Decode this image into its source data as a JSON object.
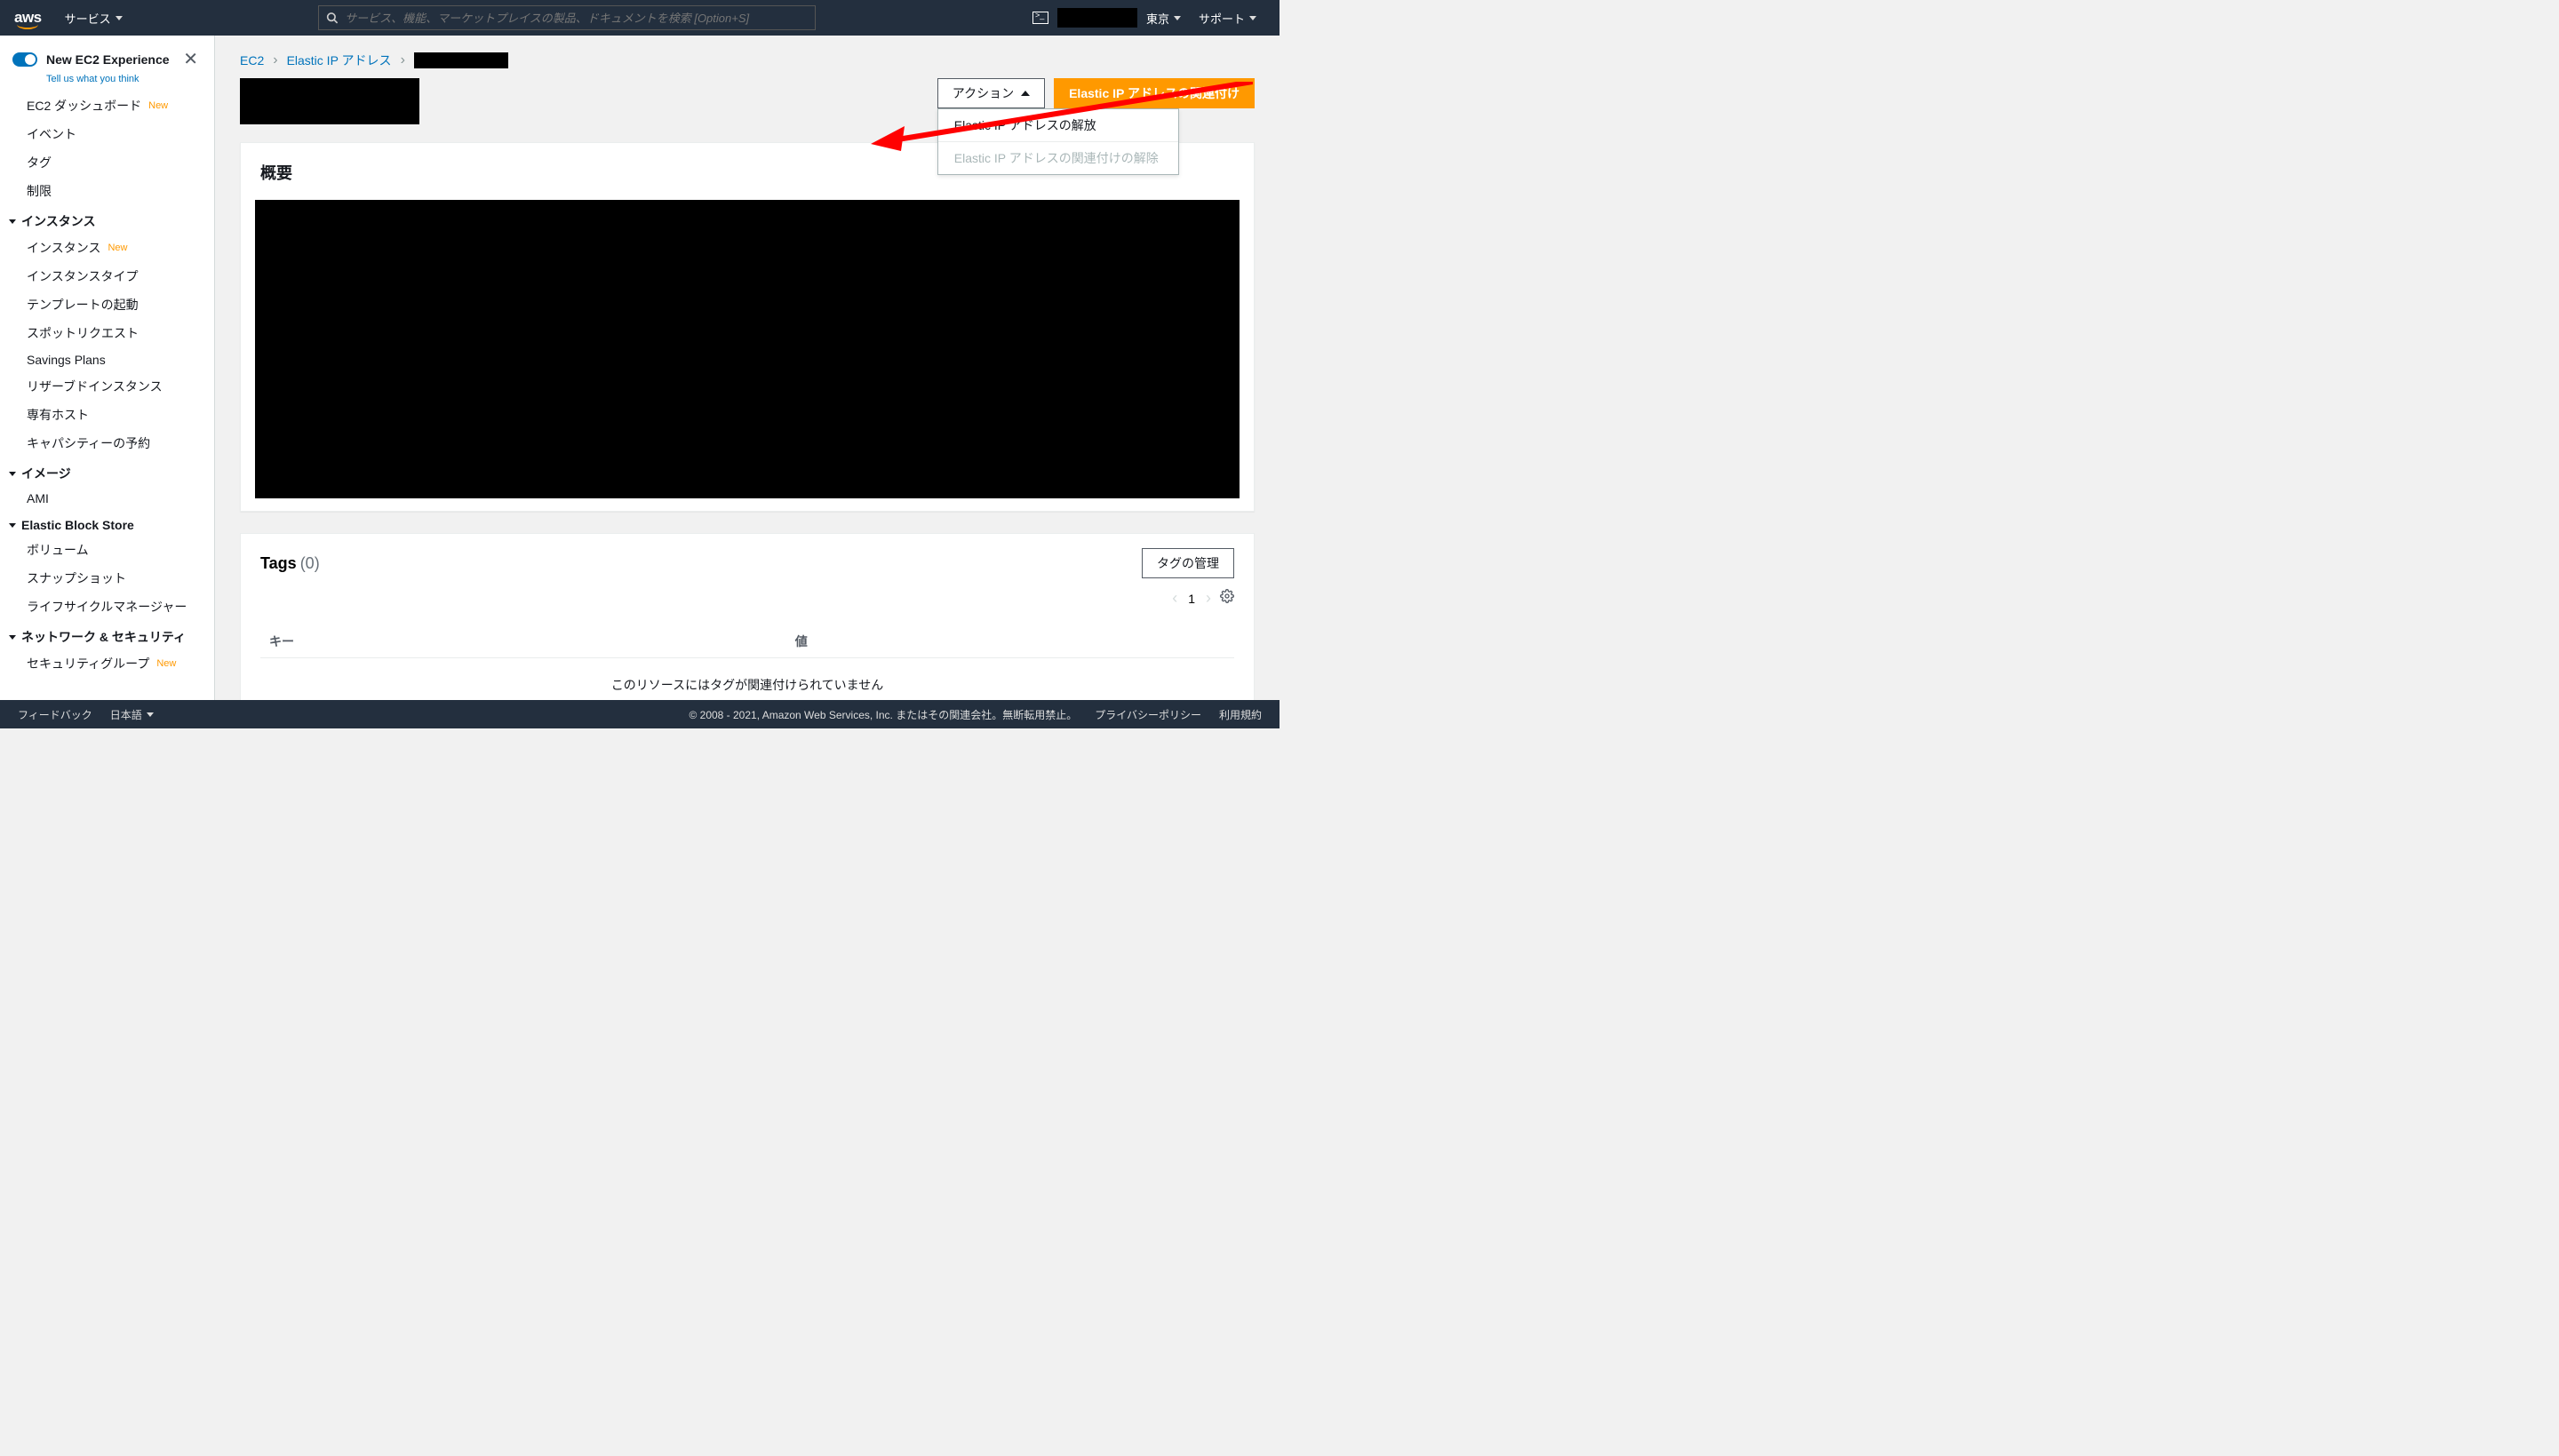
{
  "topnav": {
    "services": "サービス",
    "search_placeholder": "サービス、機能、マーケットプレイスの製品、ドキュメントを検索 [Option+S]",
    "region": "東京",
    "support": "サポート"
  },
  "sidebar": {
    "new_experience": "New EC2 Experience",
    "tell_us": "Tell us what you think",
    "items_top": [
      {
        "label": "EC2 ダッシュボード",
        "new": true
      },
      {
        "label": "イベント",
        "new": false
      },
      {
        "label": "タグ",
        "new": false
      },
      {
        "label": "制限",
        "new": false
      }
    ],
    "sections": [
      {
        "title": "インスタンス",
        "items": [
          {
            "label": "インスタンス",
            "new": true
          },
          {
            "label": "インスタンスタイプ",
            "new": false
          },
          {
            "label": "テンプレートの起動",
            "new": false
          },
          {
            "label": "スポットリクエスト",
            "new": false
          },
          {
            "label": "Savings Plans",
            "new": false
          },
          {
            "label": "リザーブドインスタンス",
            "new": false
          },
          {
            "label": "専有ホスト",
            "new": false
          },
          {
            "label": "キャパシティーの予約",
            "new": false
          }
        ]
      },
      {
        "title": "イメージ",
        "items": [
          {
            "label": "AMI",
            "new": false
          }
        ]
      },
      {
        "title": "Elastic Block Store",
        "items": [
          {
            "label": "ボリューム",
            "new": false
          },
          {
            "label": "スナップショット",
            "new": false
          },
          {
            "label": "ライフサイクルマネージャー",
            "new": false
          }
        ]
      },
      {
        "title": "ネットワーク & セキュリティ",
        "items": [
          {
            "label": "セキュリティグループ",
            "new": true
          }
        ]
      }
    ],
    "new_badge": "New"
  },
  "breadcrumb": {
    "root": "EC2",
    "second": "Elastic IP アドレス"
  },
  "actions": {
    "button": "アクション",
    "menu": {
      "release": "Elastic IP アドレスの解放",
      "disassociate": "Elastic IP アドレスの関連付けの解除"
    },
    "associate": "Elastic IP アドレスの関連付け"
  },
  "summary": {
    "title": "概要"
  },
  "tags": {
    "title": "Tags",
    "count": "(0)",
    "manage": "タグの管理",
    "page": "1",
    "col_key": "キー",
    "col_value": "値",
    "empty": "このリソースにはタグが関連付けられていません"
  },
  "footer": {
    "feedback": "フィードバック",
    "language": "日本語",
    "copyright": "© 2008 - 2021, Amazon Web Services, Inc. またはその関連会社。無断転用禁止。",
    "privacy": "プライバシーポリシー",
    "terms": "利用規約"
  }
}
